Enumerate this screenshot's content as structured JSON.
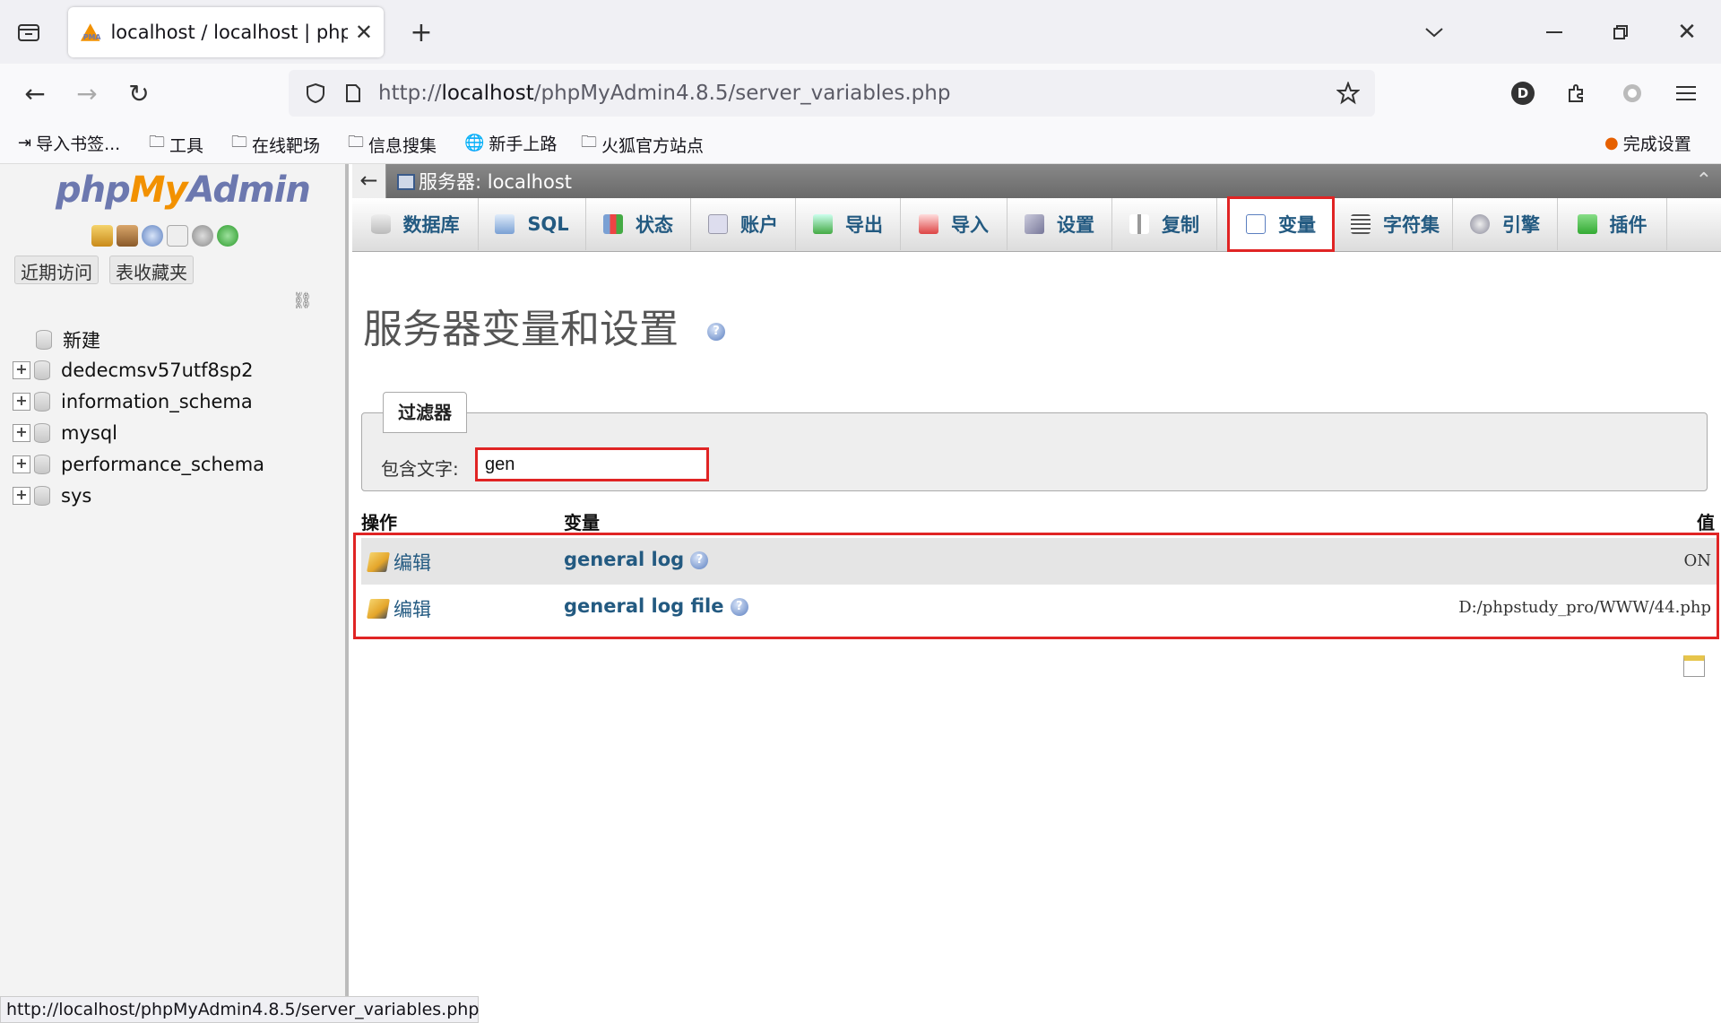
{
  "browser": {
    "tab_title": "localhost / localhost | phpMyAdmin",
    "url_prefix": "http://",
    "url_host": "localhost",
    "url_path": "/phpMyAdmin4.8.5/server_variables.php",
    "status_url": "http://localhost/phpMyAdmin4.8.5/server_variables.php",
    "profile_initial": "D",
    "bookmarks": [
      "导入书签...",
      "工具",
      "在线靶场",
      "信息搜集",
      "新手上路",
      "火狐官方站点"
    ],
    "setup_label": "完成设置"
  },
  "pma_nav": {
    "logo_php": "php",
    "logo_my": "My",
    "logo_admin": "Admin",
    "recent_btn": "近期访问",
    "favorites_btn": "表收藏夹",
    "new_item": "新建",
    "databases": [
      "dedecmsv57utf8sp2",
      "information_schema",
      "mysql",
      "performance_schema",
      "sys"
    ]
  },
  "main": {
    "server_label": "服务器: localhost",
    "tabs": [
      "数据库",
      "SQL",
      "状态",
      "账户",
      "导出",
      "导入",
      "设置",
      "复制",
      "变量",
      "字符集",
      "引擎",
      "插件"
    ],
    "active_tab": "变量",
    "page_title": "服务器变量和设置",
    "filter": {
      "legend": "过滤器",
      "label": "包含文字:",
      "value": "gen"
    },
    "table": {
      "col_action": "操作",
      "col_variable": "变量",
      "col_value": "值",
      "rows": [
        {
          "action": "编辑",
          "name": "general log",
          "value": "ON"
        },
        {
          "action": "编辑",
          "name": "general log file",
          "value": "D:/phpstudy_pro/WWW/44.php"
        }
      ]
    }
  },
  "colors": {
    "highlight_red": "#e02424",
    "pma_link_blue": "#235a81",
    "row_highlight": "#e5e5e5"
  }
}
